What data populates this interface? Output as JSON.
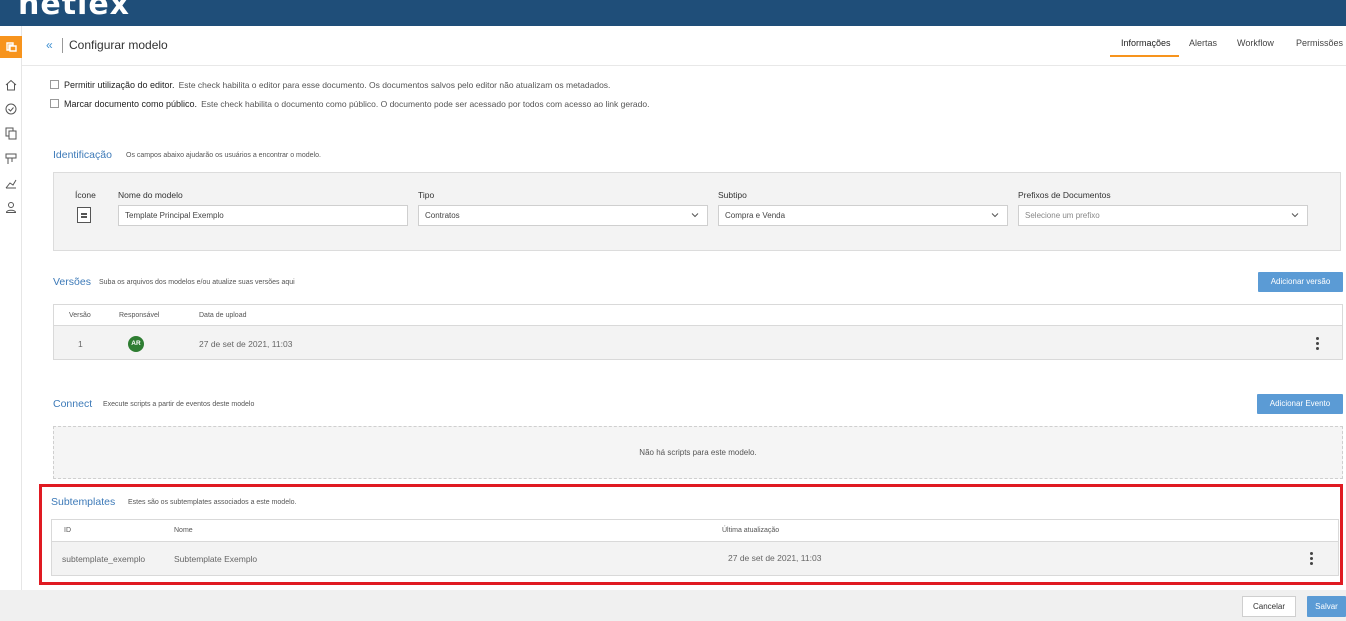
{
  "app": {
    "logo": "netlex"
  },
  "colors": {
    "topbar": "#1f4e79",
    "accent_orange": "#f7941d",
    "primary_blue": "#5b9bd5",
    "highlight_red": "#e01a22",
    "avatar_green": "#2e7d32"
  },
  "sidebar": {
    "icons": [
      "templates-icon",
      "home-icon",
      "approval-icon",
      "documents-icon",
      "kanban-icon",
      "reports-icon",
      "user-icon"
    ]
  },
  "header": {
    "back_symbol": "«",
    "title": "Configurar modelo",
    "tabs": [
      {
        "label": "Informações",
        "active": true
      },
      {
        "label": "Alertas",
        "active": false
      },
      {
        "label": "Workflow",
        "active": false
      },
      {
        "label": "Permissões",
        "active": false
      }
    ]
  },
  "options": [
    {
      "label": "Permitir utilização do editor.",
      "description": "Este check habilita o editor para esse documento. Os documentos salvos pelo editor não atualizam os metadados.",
      "checked": false
    },
    {
      "label": "Marcar documento como público.",
      "description": "Este check habilita o documento como público. O documento pode ser acessado por todos com acesso ao link gerado.",
      "checked": false
    }
  ],
  "identificacao": {
    "title": "Identificação",
    "description": "Os campos abaixo ajudarão os usuários a encontrar o modelo.",
    "icon_label": "Ícone",
    "nome_label": "Nome do modelo",
    "nome_value": "Template Principal Exemplo",
    "tipo_label": "Tipo",
    "tipo_value": "Contratos",
    "subtipo_label": "Subtipo",
    "subtipo_value": "Compra e Venda",
    "prefixos_label": "Prefixos de Documentos",
    "prefixos_placeholder": "Selecione um prefixo"
  },
  "versoes": {
    "title": "Versões",
    "description": "Suba os arquivos dos modelos e/ou atualize suas versões aqui",
    "add_button": "Adicionar versão",
    "columns": [
      "Versão",
      "Responsável",
      "Data de upload"
    ],
    "rows": [
      {
        "version": "1",
        "responsavel": "AR",
        "data": "27 de set de 2021, 11:03"
      }
    ]
  },
  "connect": {
    "title": "Connect",
    "description": "Execute scripts a partir de eventos deste modelo",
    "add_button": "Adicionar Evento",
    "empty_text": "Não há scripts para este modelo."
  },
  "subtemplates": {
    "title": "Subtemplates",
    "description": "Estes são os subtemplates associados a este modelo.",
    "columns": [
      "ID",
      "Nome",
      "Última atualização"
    ],
    "rows": [
      {
        "id": "subtemplate_exemplo",
        "nome": "Subtemplate Exemplo",
        "atualizacao": "27 de set de 2021, 11:03"
      }
    ]
  },
  "footer": {
    "cancel": "Cancelar",
    "save": "Salvar"
  }
}
